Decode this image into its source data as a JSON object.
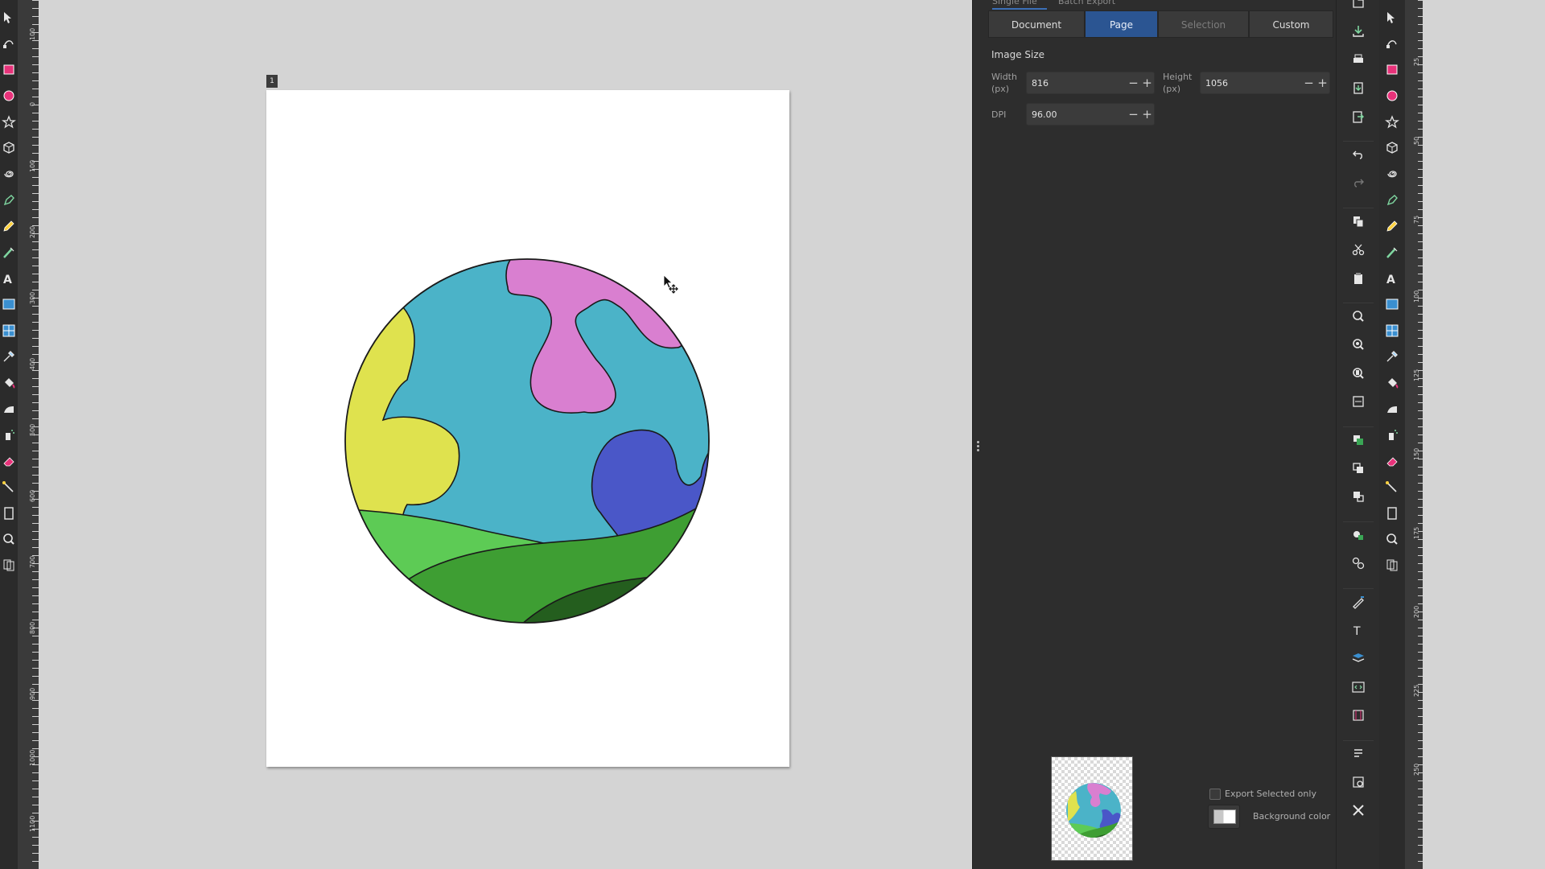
{
  "export_dialog": {
    "mode_tabs": [
      "Single File",
      "Batch Export"
    ],
    "area_buttons": [
      {
        "label": "Document",
        "state": "normal"
      },
      {
        "label": "Page",
        "state": "active"
      },
      {
        "label": "Selection",
        "state": "disabled"
      },
      {
        "label": "Custom",
        "state": "normal"
      }
    ],
    "image_size_title": "Image Size",
    "width_label": "Width\n(px)",
    "width_value": "816",
    "height_label": "Height\n(px)",
    "height_value": "1056",
    "dpi_label": "DPI",
    "dpi_value": "96.00",
    "minus": "−",
    "plus": "+",
    "export_selected_only": "Export Selected only",
    "export_selected_checked": false,
    "background_color_label": "Background color"
  },
  "canvas": {
    "page_number": "1",
    "artwork_colors": {
      "sky": "#4bb3c8",
      "pink": "#d97fd0",
      "yellow": "#dfe24e",
      "blue": "#4a57c8",
      "light_green": "#5dcb55",
      "mid_green": "#3e9e33",
      "dark_green": "#245e1e"
    }
  },
  "rulers": {
    "left_labels": [
      "100",
      "0",
      "100",
      "200",
      "300",
      "400",
      "500",
      "600",
      "700",
      "800",
      "900",
      "1000",
      "1100"
    ],
    "right_labels": [
      "25",
      "50",
      "75",
      "100",
      "125",
      "150",
      "175",
      "200",
      "225",
      "250"
    ]
  },
  "left_tools": [
    "selector-icon",
    "node-icon",
    "rectangle-icon",
    "ellipse-icon",
    "star-icon",
    "box3d-icon",
    "spiral-icon",
    "pen-icon",
    "pencil-icon",
    "calligraphy-icon",
    "text-icon",
    "gradient-icon",
    "mesh-icon",
    "dropper-icon",
    "paint-bucket-icon",
    "tweak-icon",
    "spray-icon",
    "eraser-icon",
    "connector-icon",
    "pages-icon",
    "zoom-icon",
    "measure-icon"
  ],
  "command_icons": [
    "open-icon",
    "save-icon",
    "print-icon",
    "import-icon",
    "export-icon",
    "undo-icon",
    "redo-icon",
    "copy-icon",
    "cut-icon",
    "paste-icon",
    "zoom-selection-icon",
    "zoom-drawing-icon",
    "zoom-page-icon",
    "zoom-page-width-icon",
    "duplicate-icon",
    "clone-icon",
    "unlink-clone-icon",
    "group-icon",
    "ungroup-icon",
    "fill-stroke-icon",
    "text-font-icon",
    "layers-icon",
    "xml-editor-icon",
    "align-icon",
    "document-properties-icon",
    "preferences-icon",
    "tools-icon"
  ],
  "theme": {
    "accent": "#2b5592",
    "panel_bg": "#2d2d2d",
    "canvas_bg": "#d4d4d4"
  }
}
